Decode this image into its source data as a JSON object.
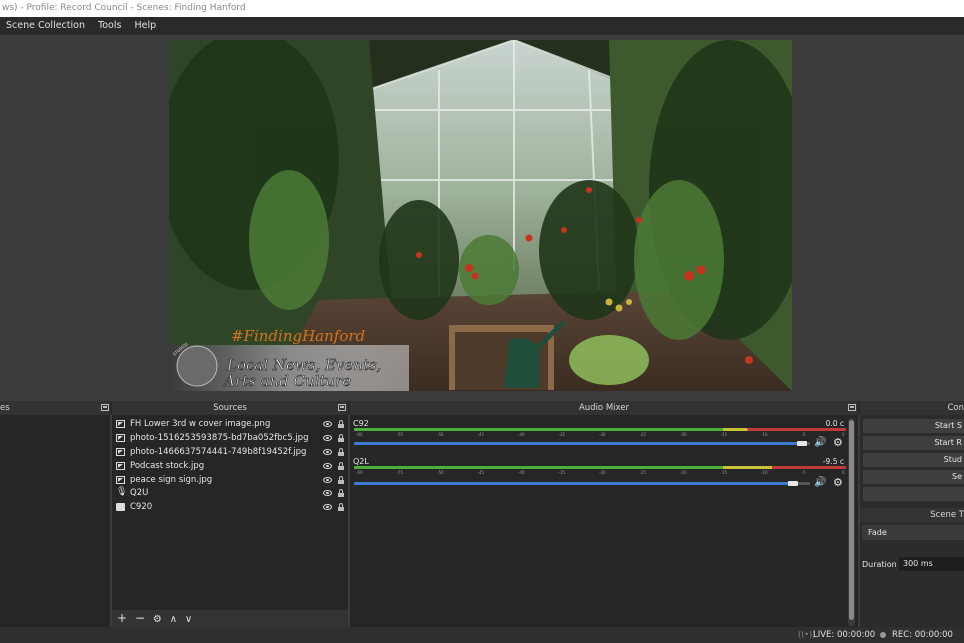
{
  "window": {
    "title": "ws) - Profile: Record Council - Scenes: Finding Hanford"
  },
  "menu": {
    "items": [
      "Scene Collection",
      "Tools",
      "Help"
    ]
  },
  "preview": {
    "hashtag": "#FindingHanford",
    "lower_third_line1": "Local News, Events,",
    "lower_third_line2": "Arts and Culture",
    "badge_text": "STUDIOS"
  },
  "docks": {
    "scenes_title": "es",
    "sources_title": "Sources",
    "mixer_title": "Audio Mixer",
    "controls_title": "Con"
  },
  "sources": {
    "items": [
      {
        "label": "FH Lower 3rd w cover image.png",
        "icon": "image-icon"
      },
      {
        "label": "photo-1516253593875-bd7ba052fbc5.jpg",
        "icon": "image-icon"
      },
      {
        "label": "photo-1466637574441-749b8f19452f.jpg",
        "icon": "image-icon"
      },
      {
        "label": "Podcast stock.jpg",
        "icon": "image-icon"
      },
      {
        "label": "peace sign sign.jpg",
        "icon": "image-icon"
      },
      {
        "label": "Q2U",
        "icon": "microphone-icon"
      },
      {
        "label": "C920",
        "icon": "camera-icon"
      }
    ],
    "toolbar": {
      "add": "+",
      "remove": "−",
      "settings": "⚙",
      "up": "∧",
      "down": "∨"
    }
  },
  "mixer": {
    "channels": [
      {
        "name": "C92",
        "db": "0.0 c",
        "volume": 0.99,
        "level": 0.8
      },
      {
        "name": "Q2L",
        "db": "-9.5 c",
        "volume": 0.97,
        "level": 0.85
      }
    ],
    "tick_labels": [
      "-60",
      "-55",
      "-50",
      "-45",
      "-40",
      "-35",
      "-30",
      "-25",
      "-20",
      "-15",
      "-10",
      "-5",
      "0"
    ]
  },
  "controls": {
    "buttons": [
      "Start S",
      "Start R",
      "Stud",
      "Se",
      ""
    ]
  },
  "transitions": {
    "title": "Scene T",
    "selected": "Fade",
    "duration_label": "Duration",
    "duration_value": "300 ms"
  },
  "status": {
    "live": "LIVE: 00:00:00",
    "rec": "REC: 00:00:00"
  },
  "colors": {
    "meter_green": "#4caf36",
    "meter_yellow": "#c8c23a",
    "meter_red": "#c03a3a",
    "volume_blue": "#3b7bd4"
  }
}
